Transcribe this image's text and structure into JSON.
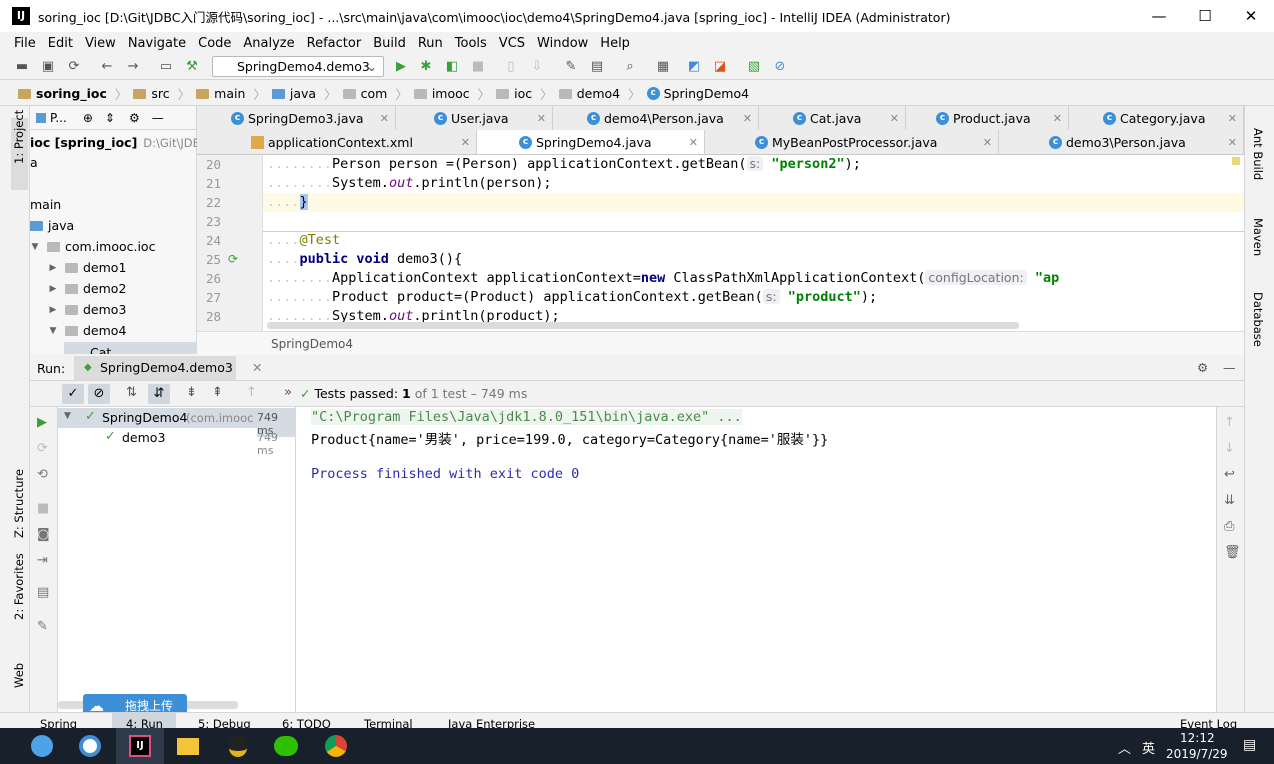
{
  "window": {
    "title": "soring_ioc [D:\\Git\\JDBC入门源代码\\soring_ioc] - ...\\src\\main\\java\\com\\imooc\\ioc\\demo4\\SpringDemo4.java [spring_ioc] - IntelliJ IDEA (Administrator)",
    "app_icon_text": "IJ",
    "controls": [
      "—",
      "☐",
      "✕"
    ]
  },
  "menu": [
    "File",
    "Edit",
    "View",
    "Navigate",
    "Code",
    "Analyze",
    "Refactor",
    "Build",
    "Run",
    "Tools",
    "VCS",
    "Window",
    "Help"
  ],
  "toolbar": {
    "run_config": "SpringDemo4.demo3"
  },
  "breadcrumbs": [
    "soring_ioc",
    "src",
    "main",
    "java",
    "com",
    "imooc",
    "ioc",
    "demo4",
    "SpringDemo4"
  ],
  "left_strip": {
    "project": "1: Project",
    "structure": "Z: Structure",
    "favorites": "2: Favorites",
    "web": "Web"
  },
  "right_strip": {
    "ant": "Ant Build",
    "maven": "Maven",
    "database": "Database"
  },
  "project_panel": {
    "header": "P...",
    "root_name": "ioc [spring_ioc]",
    "root_path": "D:\\Git\\JDBC",
    "rows": [
      "a",
      "main",
      "java",
      "com.imooc.ioc",
      "demo1",
      "demo2",
      "demo3",
      "demo4",
      "Cat"
    ]
  },
  "tabs_row1": [
    "SpringDemo3.java",
    "User.java",
    "demo4\\Person.java",
    "Cat.java",
    "Product.java",
    "Category.java"
  ],
  "tabs_row2": [
    "applicationContext.xml",
    "SpringDemo4.java",
    "MyBeanPostProcessor.java",
    "demo3\\Person.java"
  ],
  "editor": {
    "line_numbers": [
      "20",
      "21",
      "22",
      "23",
      "24",
      "25",
      "26",
      "27",
      "28"
    ],
    "l20_a": "Person person =(Person) applicationContext.getBean(",
    "l20_hint": "s:",
    "l20_str": "\"person2\"",
    "l20_end": ");",
    "l21_a": "System.",
    "l21_b": "out",
    "l21_c": ".println(person);",
    "l22": "}",
    "l24": "@Test",
    "l25_kw": "public void",
    "l25_rest": " demo3(){",
    "l26_a": "ApplicationContext applicationContext=",
    "l26_kw": "new",
    "l26_b": " ClassPathXmlApplicationContext(",
    "l26_hint": "configLocation:",
    "l26_str": "\"ap",
    "l27_a": "Product product=(Product) applicationContext.getBean(",
    "l27_hint": "s:",
    "l27_str": "\"product\"",
    "l27_end": ");",
    "l28_a": "System.",
    "l28_b": "out",
    "l28_c": ".println(product);",
    "crumb": "SpringDemo4"
  },
  "run": {
    "label": "Run:",
    "config": "SpringDemo4.demo3",
    "status_label": "Tests passed:",
    "status_count": "1",
    "status_of": "of 1 test – 749 ms",
    "tree": [
      {
        "name": "SpringDemo4",
        "detail": "(com.imooc",
        "time": "749 ms"
      },
      {
        "name": "demo3",
        "detail": "",
        "time": "749 ms"
      }
    ],
    "console": [
      "\"C:\\Program Files\\Java\\jdk1.8.0_151\\bin\\java.exe\" ...",
      "Product{name='男装', price=199.0, category=Category{name='服装'}}",
      "",
      "Process finished with exit code 0"
    ]
  },
  "bottom_tabs": [
    "Spring",
    "4: Run",
    "5: Debug",
    "6: TODO",
    "Terminal",
    "Java Enterprise",
    "Event Log"
  ],
  "overlay_badge": "拖拽上传",
  "taskbar": {
    "ime": "英",
    "time": "12:12",
    "date": "2019/7/29",
    "tray_caret": "︿"
  },
  "colors": {
    "accent": "#3d8fd8",
    "string": "#008000",
    "keyword": "#000080",
    "pass": "#3d9a3d",
    "console_cmd": "#4a8a4a",
    "console_info": "#2c2cb0"
  }
}
